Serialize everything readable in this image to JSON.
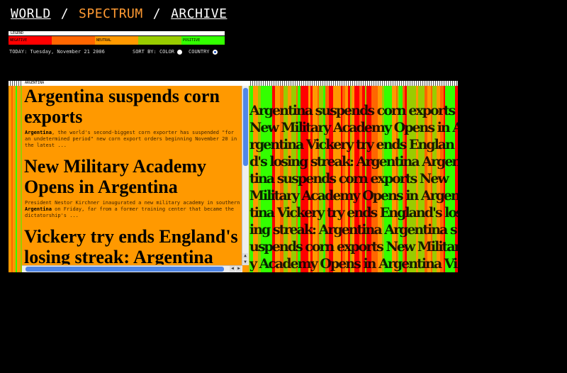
{
  "nav": {
    "world": "WORLD",
    "spectrum": "SPECTRUM",
    "archive": "ARCHIVE",
    "separator": "/"
  },
  "legend": {
    "title": "LEGEND",
    "labels": [
      "NEGATIVE",
      "",
      "NEUTRAL",
      "",
      "POSITIVE"
    ],
    "colors": [
      "#ff0000",
      "#ff6600",
      "#ff9900",
      "#99cc00",
      "#33ff00"
    ]
  },
  "today": "TODAY: Tuesday, November 21 2006",
  "sort": {
    "label": "SORT BY:",
    "color_label": "COLOR",
    "country_label": "COUNTRY",
    "selected": "country"
  },
  "panel": {
    "country": "ARGENTINA",
    "articles": [
      {
        "headline": "Argentina suspends corn exports",
        "keyword": "Argentina",
        "snippet": ", the world's second-biggest corn exporter has suspended \"for an undetermined period\" new corn export orders beginning November 20 in the latest ..."
      },
      {
        "headline": "New Military Academy Opens in Argentina",
        "pre": "President Nestor Kirchner inaugurated a new military academy in southern ",
        "keyword": "Argentina",
        "snippet": " on Friday, far from a former training center that became the dictatorship's ..."
      },
      {
        "headline": "Vickery try ends England's losing streak: Argentina"
      }
    ]
  },
  "accent_color": "#ff9a33"
}
